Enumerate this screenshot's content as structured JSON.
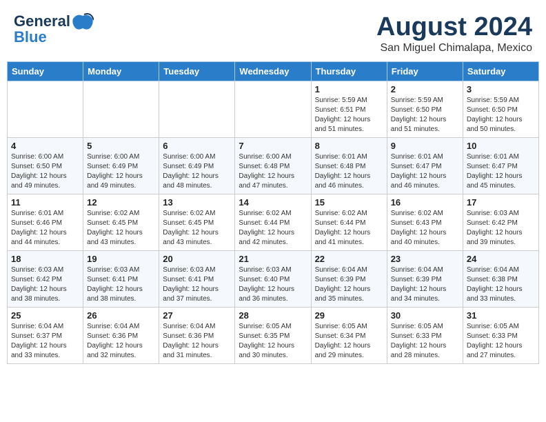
{
  "header": {
    "logo_line1": "General",
    "logo_line2": "Blue",
    "month_title": "August 2024",
    "location": "San Miguel Chimalapa, Mexico"
  },
  "calendar": {
    "days_of_week": [
      "Sunday",
      "Monday",
      "Tuesday",
      "Wednesday",
      "Thursday",
      "Friday",
      "Saturday"
    ],
    "weeks": [
      [
        {
          "day": "",
          "info": ""
        },
        {
          "day": "",
          "info": ""
        },
        {
          "day": "",
          "info": ""
        },
        {
          "day": "",
          "info": ""
        },
        {
          "day": "1",
          "info": "Sunrise: 5:59 AM\nSunset: 6:51 PM\nDaylight: 12 hours\nand 51 minutes."
        },
        {
          "day": "2",
          "info": "Sunrise: 5:59 AM\nSunset: 6:50 PM\nDaylight: 12 hours\nand 51 minutes."
        },
        {
          "day": "3",
          "info": "Sunrise: 5:59 AM\nSunset: 6:50 PM\nDaylight: 12 hours\nand 50 minutes."
        }
      ],
      [
        {
          "day": "4",
          "info": "Sunrise: 6:00 AM\nSunset: 6:50 PM\nDaylight: 12 hours\nand 49 minutes."
        },
        {
          "day": "5",
          "info": "Sunrise: 6:00 AM\nSunset: 6:49 PM\nDaylight: 12 hours\nand 49 minutes."
        },
        {
          "day": "6",
          "info": "Sunrise: 6:00 AM\nSunset: 6:49 PM\nDaylight: 12 hours\nand 48 minutes."
        },
        {
          "day": "7",
          "info": "Sunrise: 6:00 AM\nSunset: 6:48 PM\nDaylight: 12 hours\nand 47 minutes."
        },
        {
          "day": "8",
          "info": "Sunrise: 6:01 AM\nSunset: 6:48 PM\nDaylight: 12 hours\nand 46 minutes."
        },
        {
          "day": "9",
          "info": "Sunrise: 6:01 AM\nSunset: 6:47 PM\nDaylight: 12 hours\nand 46 minutes."
        },
        {
          "day": "10",
          "info": "Sunrise: 6:01 AM\nSunset: 6:47 PM\nDaylight: 12 hours\nand 45 minutes."
        }
      ],
      [
        {
          "day": "11",
          "info": "Sunrise: 6:01 AM\nSunset: 6:46 PM\nDaylight: 12 hours\nand 44 minutes."
        },
        {
          "day": "12",
          "info": "Sunrise: 6:02 AM\nSunset: 6:45 PM\nDaylight: 12 hours\nand 43 minutes."
        },
        {
          "day": "13",
          "info": "Sunrise: 6:02 AM\nSunset: 6:45 PM\nDaylight: 12 hours\nand 43 minutes."
        },
        {
          "day": "14",
          "info": "Sunrise: 6:02 AM\nSunset: 6:44 PM\nDaylight: 12 hours\nand 42 minutes."
        },
        {
          "day": "15",
          "info": "Sunrise: 6:02 AM\nSunset: 6:44 PM\nDaylight: 12 hours\nand 41 minutes."
        },
        {
          "day": "16",
          "info": "Sunrise: 6:02 AM\nSunset: 6:43 PM\nDaylight: 12 hours\nand 40 minutes."
        },
        {
          "day": "17",
          "info": "Sunrise: 6:03 AM\nSunset: 6:42 PM\nDaylight: 12 hours\nand 39 minutes."
        }
      ],
      [
        {
          "day": "18",
          "info": "Sunrise: 6:03 AM\nSunset: 6:42 PM\nDaylight: 12 hours\nand 38 minutes."
        },
        {
          "day": "19",
          "info": "Sunrise: 6:03 AM\nSunset: 6:41 PM\nDaylight: 12 hours\nand 38 minutes."
        },
        {
          "day": "20",
          "info": "Sunrise: 6:03 AM\nSunset: 6:41 PM\nDaylight: 12 hours\nand 37 minutes."
        },
        {
          "day": "21",
          "info": "Sunrise: 6:03 AM\nSunset: 6:40 PM\nDaylight: 12 hours\nand 36 minutes."
        },
        {
          "day": "22",
          "info": "Sunrise: 6:04 AM\nSunset: 6:39 PM\nDaylight: 12 hours\nand 35 minutes."
        },
        {
          "day": "23",
          "info": "Sunrise: 6:04 AM\nSunset: 6:39 PM\nDaylight: 12 hours\nand 34 minutes."
        },
        {
          "day": "24",
          "info": "Sunrise: 6:04 AM\nSunset: 6:38 PM\nDaylight: 12 hours\nand 33 minutes."
        }
      ],
      [
        {
          "day": "25",
          "info": "Sunrise: 6:04 AM\nSunset: 6:37 PM\nDaylight: 12 hours\nand 33 minutes."
        },
        {
          "day": "26",
          "info": "Sunrise: 6:04 AM\nSunset: 6:36 PM\nDaylight: 12 hours\nand 32 minutes."
        },
        {
          "day": "27",
          "info": "Sunrise: 6:04 AM\nSunset: 6:36 PM\nDaylight: 12 hours\nand 31 minutes."
        },
        {
          "day": "28",
          "info": "Sunrise: 6:05 AM\nSunset: 6:35 PM\nDaylight: 12 hours\nand 30 minutes."
        },
        {
          "day": "29",
          "info": "Sunrise: 6:05 AM\nSunset: 6:34 PM\nDaylight: 12 hours\nand 29 minutes."
        },
        {
          "day": "30",
          "info": "Sunrise: 6:05 AM\nSunset: 6:33 PM\nDaylight: 12 hours\nand 28 minutes."
        },
        {
          "day": "31",
          "info": "Sunrise: 6:05 AM\nSunset: 6:33 PM\nDaylight: 12 hours\nand 27 minutes."
        }
      ]
    ]
  }
}
